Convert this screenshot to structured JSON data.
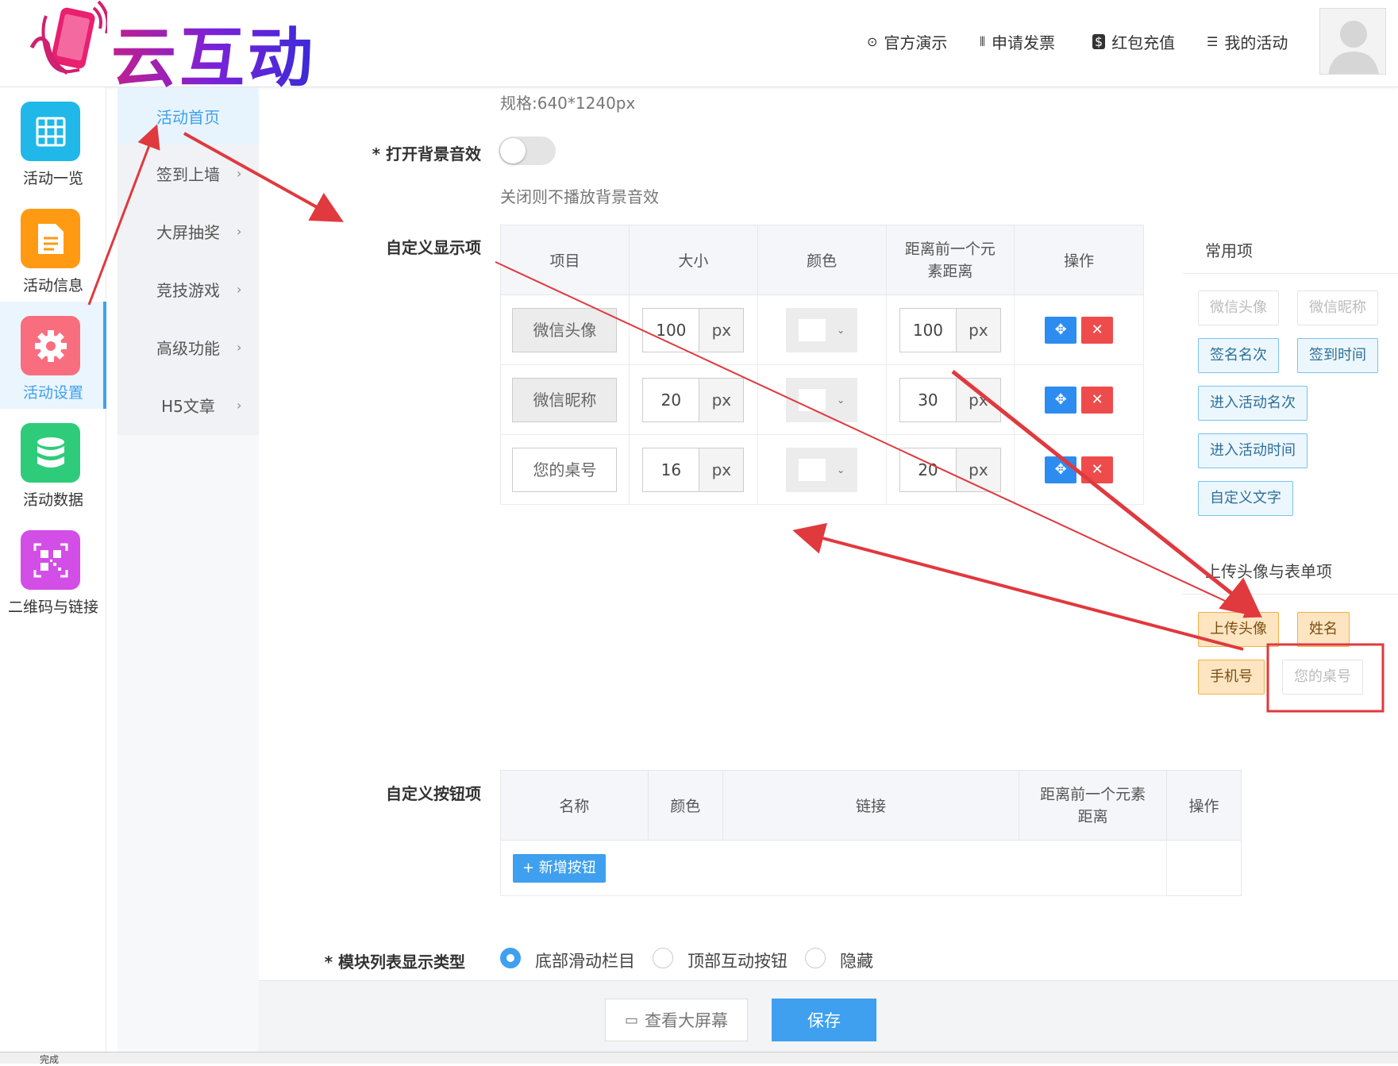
{
  "brand": {
    "logo_text": "云互动"
  },
  "topnav": [
    {
      "icon": "play-circle-icon",
      "label": "官方演示"
    },
    {
      "icon": "barcode-icon",
      "label": "申请发票"
    },
    {
      "icon": "dollar-icon",
      "label": "红包充值"
    },
    {
      "icon": "list-icon",
      "label": "我的活动"
    }
  ],
  "leftbar": [
    {
      "label": "活动一览",
      "icon": "grid-icon",
      "color": "#1fb8e8"
    },
    {
      "label": "活动信息",
      "icon": "document-icon",
      "color": "#ff9a12"
    },
    {
      "label": "活动设置",
      "icon": "gear-icon",
      "color": "#f86e7f",
      "active": true
    },
    {
      "label": "活动数据",
      "icon": "database-icon",
      "color": "#2ecc7a"
    },
    {
      "label": "二维码与链接",
      "icon": "qrcode-icon",
      "color": "#d24ee6"
    }
  ],
  "subnav": [
    {
      "label": "活动首页",
      "active": true
    },
    {
      "label": "签到上墙",
      "chevron": "›"
    },
    {
      "label": "大屏抽奖",
      "chevron": "›"
    },
    {
      "label": "竞技游戏",
      "chevron": "›"
    },
    {
      "label": "高级功能",
      "chevron": "›"
    },
    {
      "label": "H5文章",
      "chevron": "›"
    }
  ],
  "form": {
    "spec_text": "规格:640*1240px",
    "bg_sound_label": "* 打开背景音效",
    "bg_sound_on": false,
    "bg_sound_hint": "关闭则不播放背景音效",
    "display_items_label": "自定义显示项",
    "display_table": {
      "headers": [
        "项目",
        "大小",
        "颜色",
        "距离前一个元素距离",
        "操作"
      ],
      "rows": [
        {
          "name": "微信头像",
          "size": "100",
          "size_unit": "px",
          "distance": "100",
          "distance_unit": "px",
          "readonly": true
        },
        {
          "name": "微信昵称",
          "size": "20",
          "size_unit": "px",
          "distance": "30",
          "distance_unit": "px",
          "readonly": true
        },
        {
          "name": "您的桌号",
          "size": "16",
          "size_unit": "px",
          "distance": "20",
          "distance_unit": "px",
          "readonly": false
        }
      ]
    },
    "common_title": "常用项",
    "common_items": [
      "微信头像",
      "微信昵称",
      "签名名次",
      "签到时间",
      "进入活动名次",
      "进入活动时间",
      "自定义文字"
    ],
    "upload_title": "上传头像与表单项",
    "upload_items": [
      "上传头像",
      "姓名",
      "手机号",
      "您的桌号"
    ],
    "buttons_label": "自定义按钮项",
    "buttons_table": {
      "headers": [
        "名称",
        "颜色",
        "链接",
        "距离前一个元素距离",
        "操作"
      ],
      "add_button": "+ 新增按钮"
    },
    "module_label": "* 模块列表显示类型",
    "module_options": [
      "底部滑动栏目",
      "顶部互动按钮",
      "隐藏"
    ],
    "module_selected": 0
  },
  "footer": {
    "view_screen": "查看大屏幕",
    "save": "保存"
  },
  "statusbar": {
    "text": "完成"
  }
}
